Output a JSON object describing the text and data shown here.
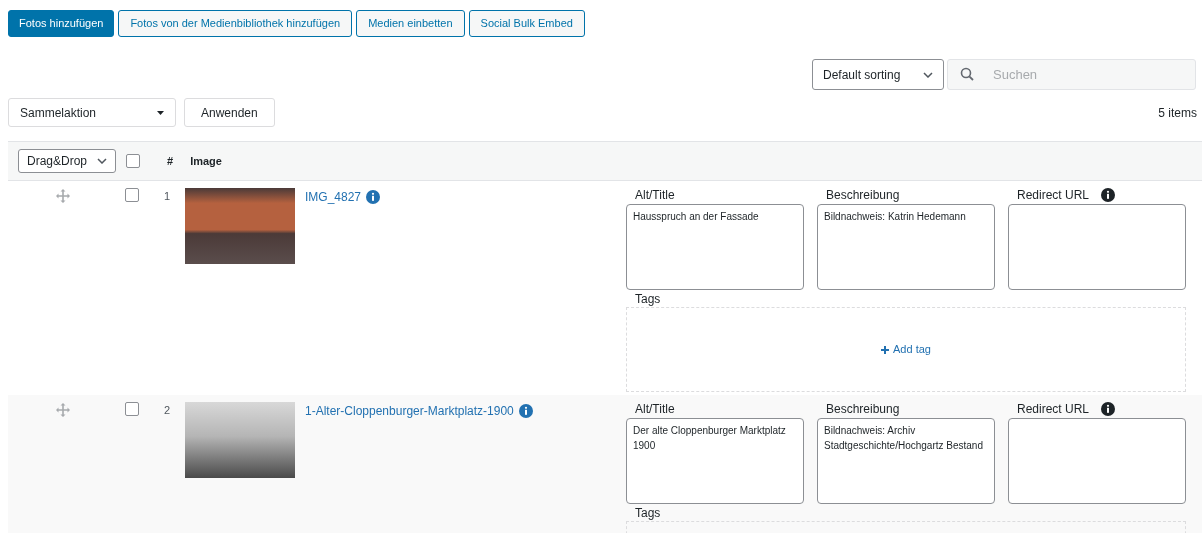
{
  "toolbar_buttons": [
    {
      "label": "Fotos hinzufügen",
      "primary": true
    },
    {
      "label": "Fotos von der Medienbibliothek hinzufügen",
      "primary": false
    },
    {
      "label": "Medien einbetten",
      "primary": false
    },
    {
      "label": "Social Bulk Embed",
      "primary": false
    }
  ],
  "sorting": {
    "value": "Default sorting"
  },
  "search": {
    "placeholder": "Suchen"
  },
  "bulk_action": {
    "value": "Sammelaktion"
  },
  "apply_button": "Anwenden",
  "item_count": "5 items",
  "table": {
    "columns": {
      "order_select": "Drag&Drop",
      "number": "#",
      "image": "Image"
    },
    "header_checked": false,
    "rows": [
      {
        "number": "1",
        "title": "IMG_4827",
        "checked": false,
        "alt_title_label": "Alt/Title",
        "alt_title": "Hausspruch an der Fassade",
        "description_label": "Beschreibung",
        "description": "Bildnachweis: Katrin Hedemann",
        "redirect_label": "Redirect URL",
        "tags_label": "Tags",
        "add_tag": "Add tag"
      },
      {
        "number": "2",
        "title": "1-Alter-Cloppenburger-Marktplatz-1900",
        "checked": false,
        "alt_title_label": "Alt/Title",
        "alt_title": "Der alte Cloppenburger Marktplatz 1900",
        "description_label": "Beschreibung",
        "description": "Bildnachweis: Archiv Stadtgeschichte/Hochgartz Bestand",
        "redirect_label": "Redirect URL",
        "tags_label": "Tags"
      }
    ]
  }
}
